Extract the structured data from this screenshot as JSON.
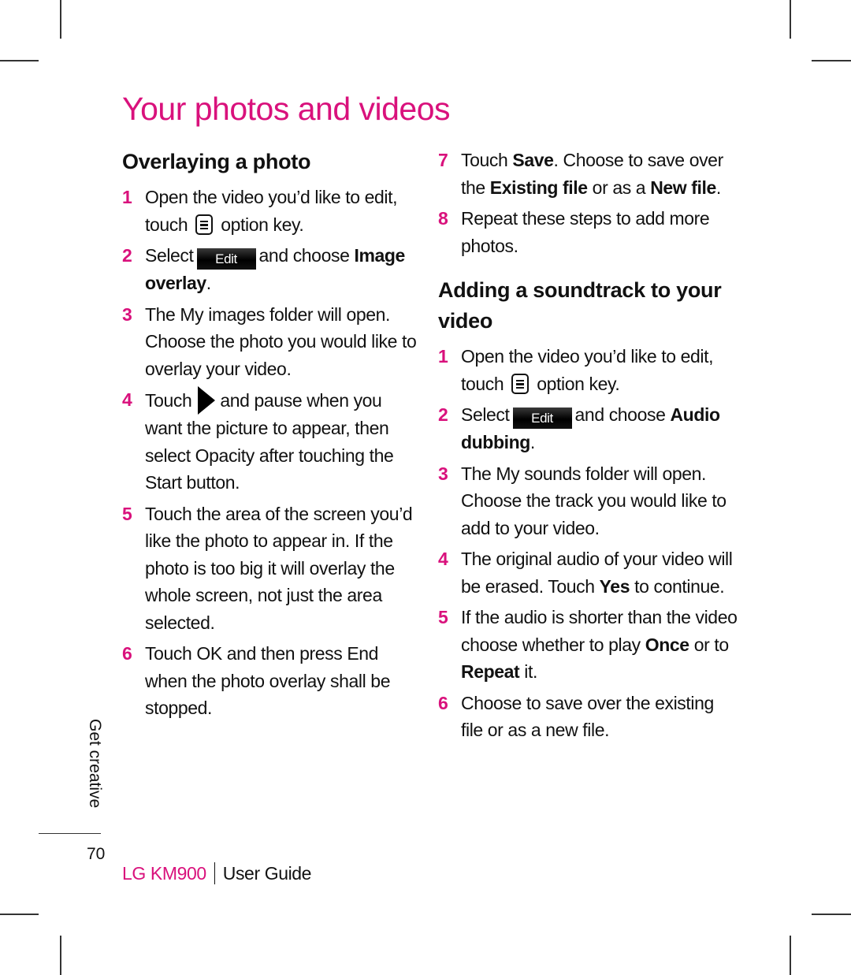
{
  "page": {
    "title": "Your photos and videos",
    "side_label": "Get creative",
    "page_number": "70",
    "footer": {
      "model": "LG KM900",
      "guide": "User Guide"
    }
  },
  "colors": {
    "accent": "#d9117c",
    "text": "#111111"
  },
  "icons": {
    "option_key": "menu-key-icon",
    "edit_button": "Edit",
    "play": "play-icon"
  },
  "sections": {
    "overlaying": {
      "heading": "Overlaying a photo",
      "steps": [
        {
          "num": "1",
          "text_a": "Open the video you’d like to edit, touch",
          "text_b": "option key."
        },
        {
          "num": "2",
          "text_a": "Select",
          "button": "Edit",
          "text_b": "and choose",
          "bold": "Image overlay",
          "text_c": "."
        },
        {
          "num": "3",
          "text": "The My images folder will open. Choose the photo you would like to overlay your video."
        },
        {
          "num": "4",
          "text_a": "Touch",
          "text_b": "and pause when you want the picture to appear, then select Opacity after touching the Start button."
        },
        {
          "num": "5",
          "text": "Touch the area of the screen you’d like the photo to appear in. If the photo is too big it will overlay the whole screen, not just the area selected."
        },
        {
          "num": "6",
          "text": "Touch OK and then press End when the photo overlay shall be stopped."
        },
        {
          "num": "7",
          "text_a": "Touch",
          "bold_a": "Save",
          "text_b": ". Choose to save over the",
          "bold_b": "Existing file",
          "text_c": "or as a",
          "bold_c": "New file",
          "text_d": "."
        },
        {
          "num": "8",
          "text": "Repeat these steps to add more photos."
        }
      ]
    },
    "soundtrack": {
      "heading": "Adding a soundtrack to your video",
      "steps": [
        {
          "num": "1",
          "text_a": "Open the video you’d like to edit, touch",
          "text_b": "option key."
        },
        {
          "num": "2",
          "text_a": "Select",
          "button": "Edit",
          "text_b": "and choose",
          "bold": "Audio dubbing",
          "text_c": "."
        },
        {
          "num": "3",
          "text": "The My sounds folder will open. Choose the track you would like to add to your video."
        },
        {
          "num": "4",
          "text_a": "The original audio of your video will be erased. Touch",
          "bold": "Yes",
          "text_b": "to continue."
        },
        {
          "num": "5",
          "text_a": "If the audio is shorter than the video choose whether to play",
          "bold_a": "Once",
          "text_b": "or to",
          "bold_b": "Repeat",
          "text_c": "it."
        },
        {
          "num": "6",
          "text": "Choose to save over the existing file or as a new file."
        }
      ]
    }
  }
}
